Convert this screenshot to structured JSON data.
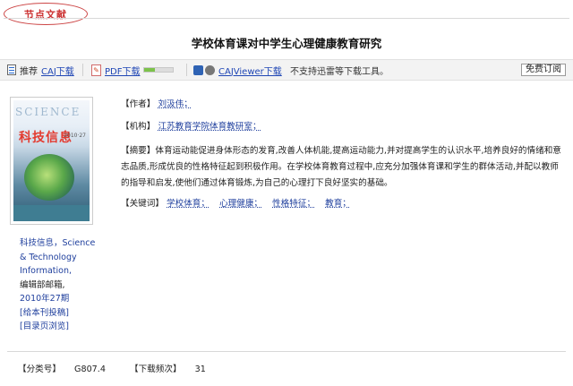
{
  "header": {
    "tag": "节点文献",
    "title": "学校体育课对中学生心理健康教育研究"
  },
  "toolbar": {
    "recommend": "推荐",
    "caj_download": "CAJ下载",
    "pdf_download": "PDF下载",
    "pdf_bar_level": 0.35,
    "cajviewer_download": "CAJViewer下载",
    "note": "不支持迅雷等下载工具。",
    "subscribe": "免费订阅"
  },
  "article": {
    "author_label": "【作者】",
    "author": "刘汲伟；",
    "org_label": "【机构】",
    "org": "江苏教育学院体育教研室；",
    "abstract_label": "【摘要】",
    "abstract": "体育运动能促进身体形态的发育,改善人体机能,提高运动能力,并对提高学生的认识水平,培养良好的情绪和意志品质,形成优良的性格特征起到积极作用。在学校体育教育过程中,应充分加强体育课和学生的群体活动,并配以教师的指导和启发,使他们通过体育锻炼,为自己的心理打下良好坚实的基础。",
    "keywords_label": "【关键词】",
    "keywords": [
      "学校体育；",
      "心理健康；",
      "性格特征；",
      "教育；"
    ]
  },
  "journal": {
    "cover_science": "SCIENCE",
    "cover_cn": "科技信息",
    "cover_small": "2010·27",
    "name": "科技信息，Science",
    "name_line2": "& Technology",
    "name_line3": "Information,",
    "editor": "编辑部邮箱,",
    "issue": "2010年27期",
    "submit_link": "[给本刊投稿]",
    "toc_link": "[目录页浏览]"
  },
  "footer": {
    "class_label": "【分类号】",
    "class_value": "G807.4",
    "downloads_label": "【下载频次】",
    "downloads_value": "31"
  }
}
